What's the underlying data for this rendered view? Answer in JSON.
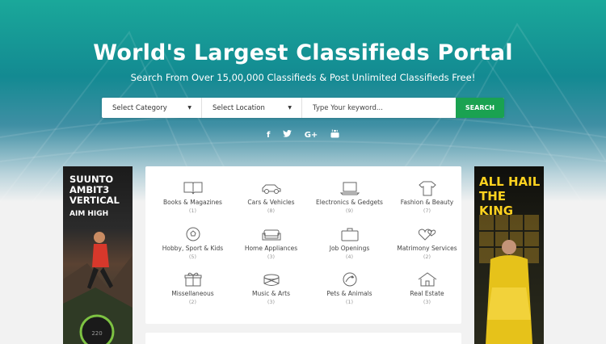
{
  "hero": {
    "title": "World's Largest Classifieds Portal",
    "subtitle": "Search From Over 15,00,000 Classifieds & Post Unlimited Classifieds Free!"
  },
  "search": {
    "category_label": "Select Category",
    "location_label": "Select Location",
    "keyword_placeholder": "Type Your keyword...",
    "button_label": "SEARCH"
  },
  "social": {
    "facebook": "f",
    "twitter": "t",
    "google": "G+",
    "youtube": "▶"
  },
  "ads": {
    "left": {
      "line1": "SUUNTO",
      "line2": "AMBIT3",
      "line3": "VERTICAL",
      "tagline": "AIM HIGH"
    },
    "right": {
      "line1": "ALL HAIL",
      "line2": "THE KING"
    }
  },
  "categories": [
    {
      "name": "Books & Magazines",
      "count": "(1)",
      "icon": "book-icon"
    },
    {
      "name": "Cars & Vehicles",
      "count": "(8)",
      "icon": "car-icon"
    },
    {
      "name": "Electronics & Gedgets",
      "count": "(9)",
      "icon": "laptop-icon"
    },
    {
      "name": "Fashion & Beauty",
      "count": "(7)",
      "icon": "shirt-icon"
    },
    {
      "name": "Hobby, Sport & Kids",
      "count": "(5)",
      "icon": "ball-icon"
    },
    {
      "name": "Home Appliances",
      "count": "(3)",
      "icon": "sofa-icon"
    },
    {
      "name": "Job Openings",
      "count": "(4)",
      "icon": "briefcase-icon"
    },
    {
      "name": "Matrimony Services",
      "count": "(2)",
      "icon": "hearts-icon"
    },
    {
      "name": "Missellaneous",
      "count": "(2)",
      "icon": "gift-icon"
    },
    {
      "name": "Music & Arts",
      "count": "(3)",
      "icon": "drum-icon"
    },
    {
      "name": "Pets & Animals",
      "count": "(1)",
      "icon": "pet-icon"
    },
    {
      "name": "Real Estate",
      "count": "(3)",
      "icon": "house-icon"
    }
  ],
  "colors": {
    "search_button": "#1aa251",
    "hero_top": "#1aa89a",
    "ad_right_text": "#ffd21f"
  }
}
